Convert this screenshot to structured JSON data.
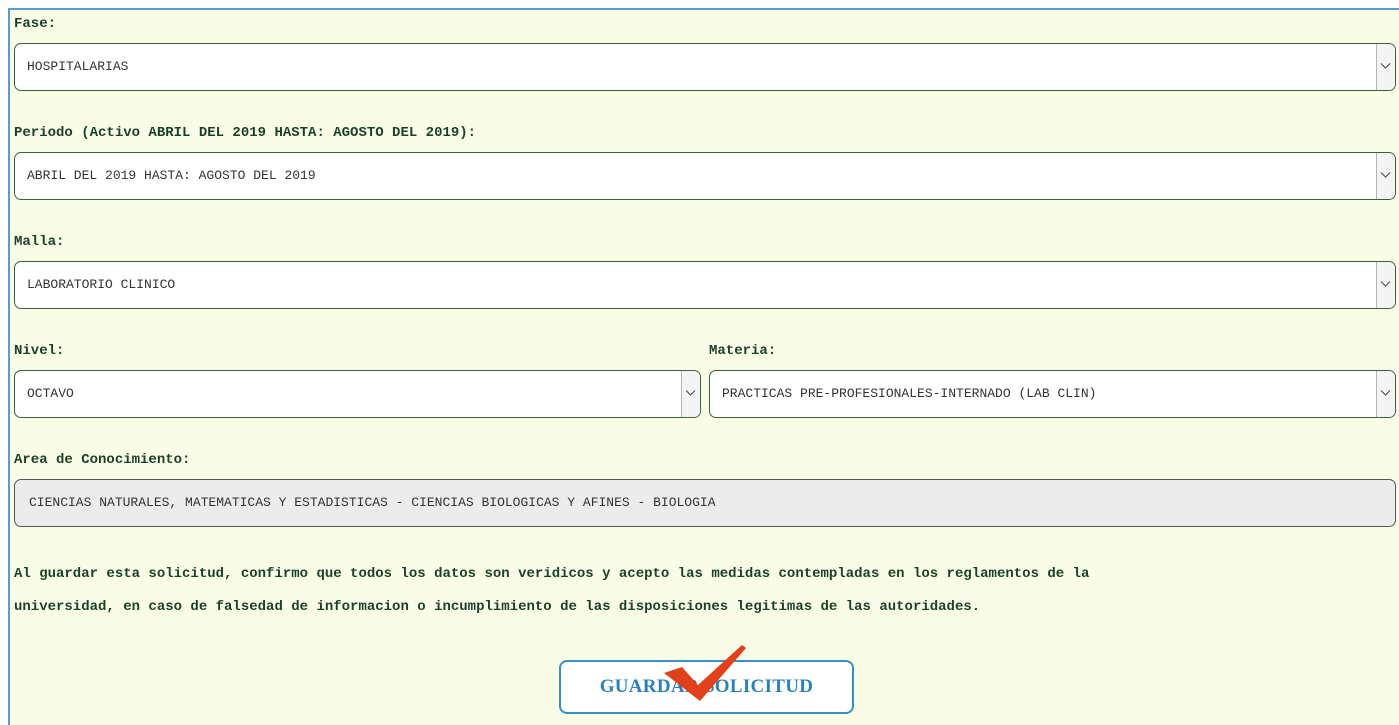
{
  "form": {
    "fase": {
      "label": "Fase:",
      "value": "HOSPITALARIAS"
    },
    "periodo": {
      "label": "Periodo (Activo ABRIL DEL 2019 HASTA: AGOSTO DEL 2019):",
      "value": "ABRIL DEL 2019 HASTA: AGOSTO DEL 2019"
    },
    "malla": {
      "label": "Malla:",
      "value": "LABORATORIO CLINICO"
    },
    "nivel": {
      "label": "Nivel:",
      "value": "OCTAVO"
    },
    "materia": {
      "label": "Materia:",
      "value": "PRACTICAS PRE-PROFESIONALES-INTERNADO (LAB CLIN)"
    },
    "area": {
      "label": "Area de Conocimiento:",
      "value": "CIENCIAS NATURALES, MATEMATICAS Y ESTADISTICAS - CIENCIAS BIOLOGICAS Y AFINES - BIOLOGIA"
    }
  },
  "disclaimer": {
    "line1": "Al guardar esta solicitud, confirmo que todos los datos son veridicos y acepto las medidas contempladas en los reglamentos de la",
    "line2": "universidad, en caso de falsedad de informacion o incumplimiento de las disposiciones legitimas de las autoridades."
  },
  "actions": {
    "save_label": "GUARDAR SOLICITUD"
  },
  "icons": {
    "dropdown": "chevron-down-icon",
    "overlay": "checkmark-icon"
  },
  "colors": {
    "panel_bg": "#fafde6",
    "label_text": "#1a3f2a",
    "button_accent": "#3a8ec6",
    "checkmark": "#e0401a"
  }
}
